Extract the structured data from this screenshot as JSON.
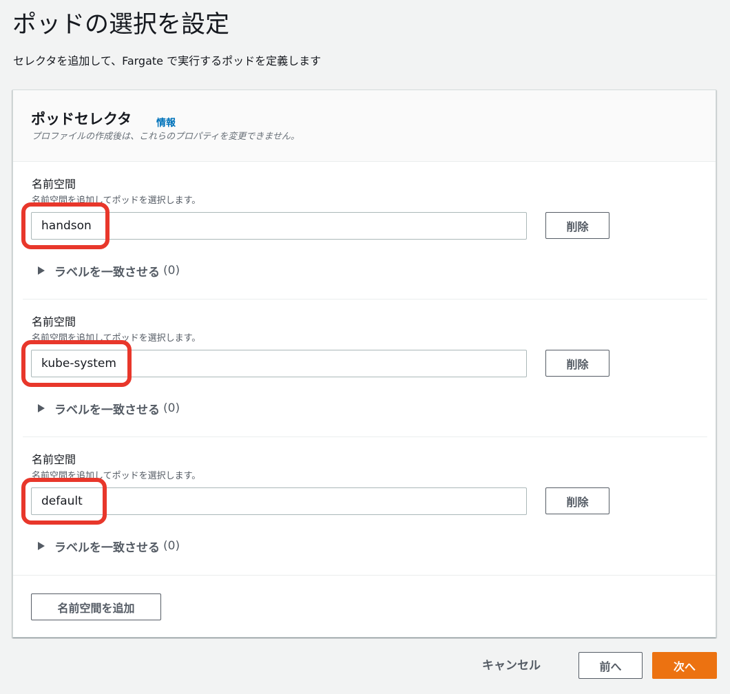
{
  "page": {
    "title": "ポッドの選択を設定",
    "description": "セレクタを追加して、Fargate で実行するポッドを定義します"
  },
  "panel": {
    "title": "ポッドセレクタ",
    "info_link": "情報",
    "subtitle": "プロファイルの作成後は、これらのプロパティを変更できません。"
  },
  "selectors": [
    {
      "label": "名前空間",
      "description": "名前空間を追加してポッドを選択します。",
      "value": "handson",
      "remove_label": "削除",
      "labels_toggle": "ラベルを一致させる",
      "labels_count": "(0)"
    },
    {
      "label": "名前空間",
      "description": "名前空間を追加してポッドを選択します。",
      "value": "kube-system",
      "remove_label": "削除",
      "labels_toggle": "ラベルを一致させる",
      "labels_count": "(0)"
    },
    {
      "label": "名前空間",
      "description": "名前空間を追加してポッドを選択します。",
      "value": "default",
      "remove_label": "削除",
      "labels_toggle": "ラベルを一致させる",
      "labels_count": "(0)"
    }
  ],
  "add_namespace_label": "名前空間を追加",
  "footer": {
    "cancel_label": "キャンセル",
    "previous_label": "前へ",
    "next_label": "次へ"
  },
  "colors": {
    "accent_orange": "#ec7211",
    "link_blue": "#0073bb",
    "highlight_red": "#e8372b"
  },
  "icons": {
    "expand": "caret-right-icon"
  }
}
